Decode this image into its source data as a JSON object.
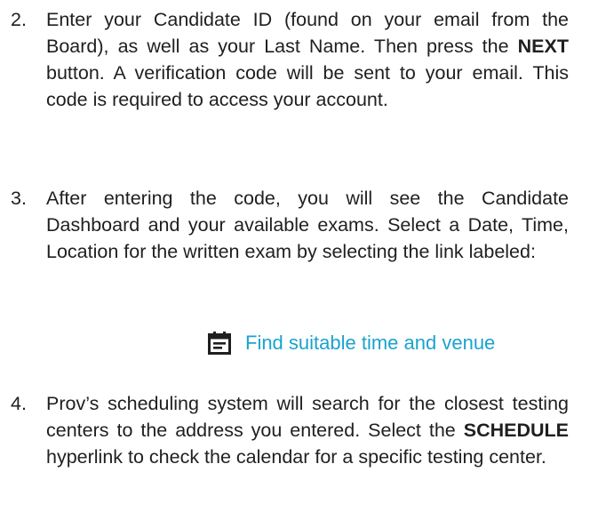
{
  "steps": [
    {
      "number": "2.",
      "part1": "Enter your Candidate ID (found on your email from the Board), as well as your Last Name.  Then press the ",
      "bold1": "NEXT",
      "part2": " button. A verification code will be sent to your email. This code is required to access your account."
    },
    {
      "number": "3.",
      "part1": "After entering the code, you will see the Candidate Dashboard and your available exams. Select a Date, Time, Location for the written exam by selecting the link labeled:"
    },
    {
      "number": "4.",
      "part1": "Prov’s scheduling system will search for the closest testing centers to the address you entered.  Select the ",
      "bold1": "SCHEDULE",
      "part2": " hyperlink to check the calendar for a specific testing center."
    }
  ],
  "link": {
    "icon": "calendar-icon",
    "label": "Find suitable time and venue",
    "color": "#1aa3cf"
  }
}
